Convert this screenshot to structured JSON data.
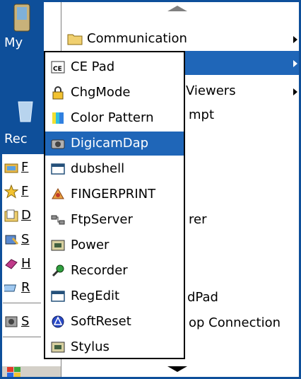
{
  "colors": {
    "desktop": "#0e4f9a",
    "highlight": "#1f66b8",
    "menu_bg": "#ffffff",
    "text": "#000000"
  },
  "desktop": {
    "my_label": "My",
    "rec_label": "Rec"
  },
  "start_menu_left": {
    "items": [
      {
        "icon": "programs-folder-icon",
        "label": "F"
      },
      {
        "icon": "favorites-star-icon",
        "label": "F"
      },
      {
        "icon": "documents-folder-icon",
        "label": "D"
      },
      {
        "icon": "settings-icon",
        "label": "S"
      },
      {
        "icon": "help-book-icon",
        "label": "H"
      },
      {
        "icon": "run-icon",
        "label": "R"
      },
      {
        "icon": "suspend-icon",
        "label": "S"
      }
    ],
    "start_icon": "windows-start-icon"
  },
  "submenu": {
    "items": [
      {
        "label": "Communication",
        "has_arrow": true
      },
      {
        "label": "",
        "has_arrow": true
      },
      {
        "label": "Viewers",
        "has_arrow": true
      },
      {
        "label": "mpt",
        "has_arrow": false
      },
      {
        "label": "",
        "has_arrow": false
      },
      {
        "label": "",
        "has_arrow": false
      },
      {
        "label": "",
        "has_arrow": false
      },
      {
        "label": "",
        "has_arrow": false
      },
      {
        "label": "rer",
        "has_arrow": false
      },
      {
        "label": "",
        "has_arrow": false
      },
      {
        "label": "",
        "has_arrow": false
      },
      {
        "label": "",
        "has_arrow": false
      },
      {
        "label": "dPad",
        "has_arrow": false
      },
      {
        "label": "op Connection",
        "has_arrow": false
      }
    ]
  },
  "popup_menu": {
    "items": [
      {
        "label": "CE Pad",
        "icon": "ce-pad-icon"
      },
      {
        "label": "ChgMode",
        "icon": "lock-icon"
      },
      {
        "label": "Color Pattern",
        "icon": "color-pattern-icon"
      },
      {
        "label": "DigicamDap",
        "icon": "camera-icon",
        "selected": true
      },
      {
        "label": "dubshell",
        "icon": "window-app-icon"
      },
      {
        "label": "FINGERPRINT",
        "icon": "fingerprint-icon"
      },
      {
        "label": "FtpServer",
        "icon": "network-icon"
      },
      {
        "label": "Power",
        "icon": "power-icon"
      },
      {
        "label": "Recorder",
        "icon": "microphone-icon"
      },
      {
        "label": "RegEdit",
        "icon": "window-app-icon"
      },
      {
        "label": "SoftReset",
        "icon": "reset-icon"
      },
      {
        "label": "Stylus",
        "icon": "stylus-icon"
      }
    ]
  }
}
